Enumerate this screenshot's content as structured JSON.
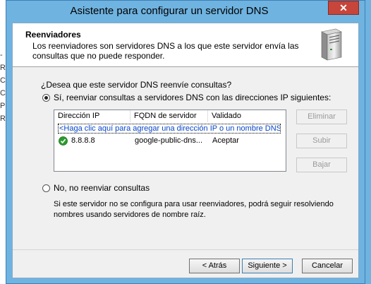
{
  "window": {
    "title": "Asistente para configurar un servidor DNS",
    "close_glyph": "✕"
  },
  "header": {
    "title": "Reenviadores",
    "description": "Los reenviadores son servidores DNS a los que este servidor envía las consultas que no puede responder."
  },
  "question": "¿Desea que este servidor DNS reenvíe consultas?",
  "option_yes": {
    "label": "Sí, reenviar consultas a servidores DNS con las direcciones IP siguientes:",
    "selected": true
  },
  "table": {
    "columns": [
      "Dirección IP",
      "FQDN de servidor",
      "Validado"
    ],
    "add_placeholder": "<Haga clic aquí para agregar una dirección IP o un nombre DNS>",
    "rows": [
      {
        "ip": "8.8.8.8",
        "fqdn": "google-public-dns...",
        "validated": "Aceptar",
        "status_icon": "check-icon"
      }
    ]
  },
  "side_buttons": {
    "delete": "Eliminar",
    "up": "Subir",
    "down": "Bajar"
  },
  "option_no": {
    "label": "No, no reenviar consultas",
    "selected": false,
    "note": "Si este servidor no se configura para usar reenviadores, podrá seguir resolviendo nombres usando servidores de nombre raíz."
  },
  "footer": {
    "back": "< Atrás",
    "next": "Siguiente >",
    "cancel": "Cancelar"
  },
  "background_glyphs": [
    "-",
    "Re",
    "Co",
    "Co",
    "Pu",
    "Re"
  ],
  "colors": {
    "desktop": "#6fb3e0",
    "close_button": "#c7453a",
    "link_text": "#0645c8",
    "check_green": "#2a9d2a"
  }
}
